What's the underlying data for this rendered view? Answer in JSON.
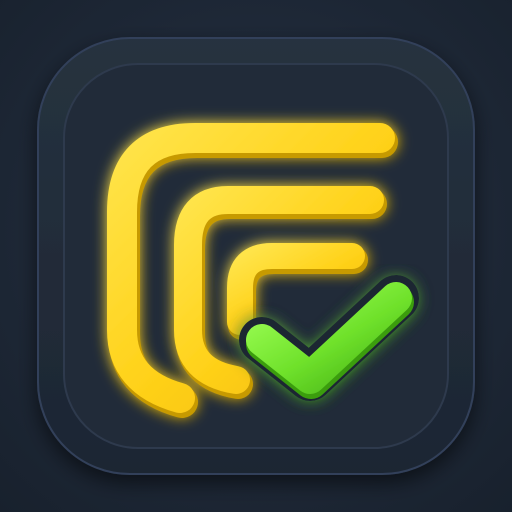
{
  "app_icon": {
    "icon_name": "stacked-layers-checkmark-icon",
    "colors": {
      "background": "#1e2837",
      "tile": "#222d3c",
      "tile_border": "#33415a",
      "layers": "#ffd21a",
      "layers_shadow": "#c79a06",
      "layers_glow": "#ffe34d",
      "check": "#6fe12b",
      "check_shadow": "#3a9d10",
      "check_glow": "#9dff55"
    }
  }
}
